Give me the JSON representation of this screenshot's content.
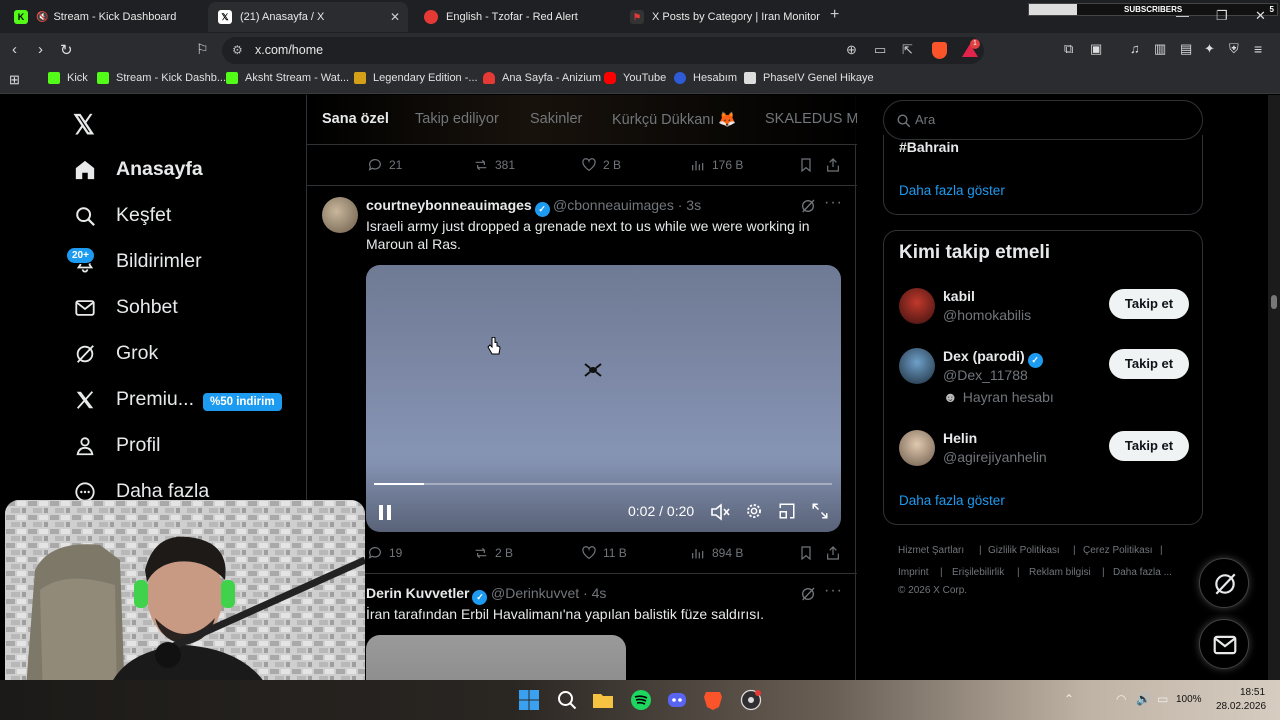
{
  "browser": {
    "tabs": [
      {
        "title": "Stream - Kick Dashboard",
        "active": false
      },
      {
        "title": "(21) Anasayfa / X",
        "active": true
      },
      {
        "title": "English - Tzofar - Red Alert",
        "active": false
      },
      {
        "title": "X Posts by Category | Iran Monitor",
        "active": false
      }
    ],
    "url": "x.com/home",
    "bookmarks": [
      "Kick",
      "Stream - Kick Dashb...",
      "Aksht Stream - Wat...",
      "Legendary Edition -...",
      "Ana Sayfa - Anizium",
      "YouTube",
      "Hesabım",
      "PhaseIV Genel Hikaye"
    ],
    "overlay": {
      "label": "SUBSCRIBERS",
      "count": "5"
    }
  },
  "nav": {
    "items": [
      {
        "label": "Anasayfa",
        "icon": "home-icon"
      },
      {
        "label": "Keşfet",
        "icon": "search-icon"
      },
      {
        "label": "Bildirimler",
        "icon": "bell-icon"
      },
      {
        "label": "Sohbet",
        "icon": "mail-icon"
      },
      {
        "label": "Grok",
        "icon": "grok-icon"
      },
      {
        "label": "Premiu...",
        "icon": "x-icon"
      },
      {
        "label": "Profil",
        "icon": "person-icon"
      },
      {
        "label": "Daha fazla",
        "icon": "more-icon"
      }
    ],
    "notif_badge": "20+",
    "premium_badge": "%50 indirim"
  },
  "timeline": {
    "tabs": [
      "Sana özel",
      "Takip ediliyor",
      "Sakinler",
      "Kürkçü Dükkanı 🦊",
      "SKALEDUS MC"
    ],
    "prev_stats": {
      "replies": "21",
      "reposts": "381",
      "likes": "2 B",
      "views": "176 B"
    },
    "tweet1": {
      "name": "courtneybonneauimages",
      "handle": "@cbonneauimages · 3s",
      "text": "Israeli army just dropped a grenade next to us while we were working in Maroun al Ras.",
      "video_time": "0:02 / 0:20",
      "progress": 0.11,
      "stats": {
        "replies": "19",
        "reposts": "2 B",
        "likes": "11 B",
        "views": "894 B"
      }
    },
    "tweet2": {
      "name": "Derin Kuvvetler",
      "handle": "@Derinkuvvet · 4s",
      "text": "İran tarafından Erbil Havalimanı'na yapılan balistik füze saldırısı."
    }
  },
  "right": {
    "search_placeholder": "Ara",
    "trend_tail": "#Bahrain",
    "show_more": "Daha fazla göster",
    "who_to_follow": "Kimi takip etmeli",
    "suggestions": [
      {
        "name": "kabil",
        "handle": "@homokabilis",
        "sub": "",
        "verified": false
      },
      {
        "name": "Dex (parodi)",
        "handle": "@Dex_11788",
        "sub": "Hayran hesabı",
        "verified": true
      },
      {
        "name": "Helin",
        "handle": "@agirejiyanhelin",
        "sub": "",
        "verified": false
      }
    ],
    "follow_label": "Takip et",
    "footer_row1": [
      "Hizmet Şartları",
      "Gizlilik Politikası",
      "Çerez Politikası"
    ],
    "footer_row2": [
      "Imprint",
      "Erişilebilirlik",
      "Reklam bilgisi",
      "Daha fazla ..."
    ],
    "copyright": "© 2026 X Corp."
  },
  "taskbar": {
    "battery": "100%",
    "time": "18:51",
    "date": "28.02.2026"
  },
  "colors": {
    "accent": "#1d9bf0",
    "bg": "#000000",
    "border": "#2f3336",
    "muted": "#71767b"
  }
}
